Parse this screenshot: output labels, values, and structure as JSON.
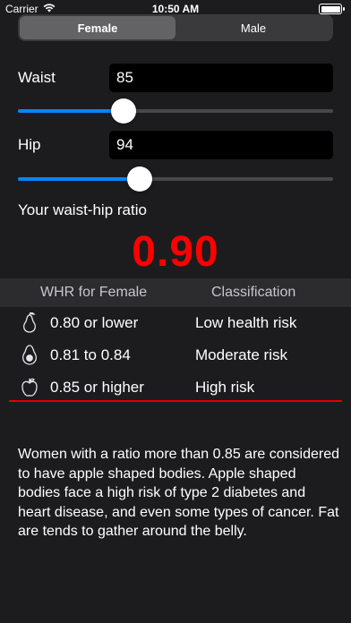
{
  "status_bar": {
    "carrier": "Carrier",
    "time": "10:50 AM"
  },
  "segmented": {
    "options": [
      "Female",
      "Male"
    ],
    "selected": "Female"
  },
  "waist": {
    "label": "Waist",
    "value": "85",
    "slider_fraction": 0.335
  },
  "hip": {
    "label": "Hip",
    "value": "94",
    "slider_fraction": 0.387
  },
  "result": {
    "label": "Your waist-hip ratio",
    "value": "0.90",
    "color": "#ff0000"
  },
  "table": {
    "header": {
      "col1": "WHR for Female",
      "col2": "Classification"
    },
    "rows": [
      {
        "icon": "pear-icon",
        "range": "0.80 or lower",
        "classification": "Low health risk"
      },
      {
        "icon": "avocado-icon",
        "range": "0.81 to 0.84",
        "classification": "Moderate risk"
      },
      {
        "icon": "apple-icon",
        "range": "0.85 or higher",
        "classification": "High risk"
      }
    ]
  },
  "description": "Women with a ratio more than 0.85 are considered to have apple shaped bodies. Apple shaped bodies face a high risk of type 2 diabetes and heart disease, and even some types of cancer. Fat are tends to gather around the belly.",
  "colors": {
    "accent": "#0a84ff",
    "highlight_line": "#e00000",
    "background": "#1c1c1e"
  }
}
